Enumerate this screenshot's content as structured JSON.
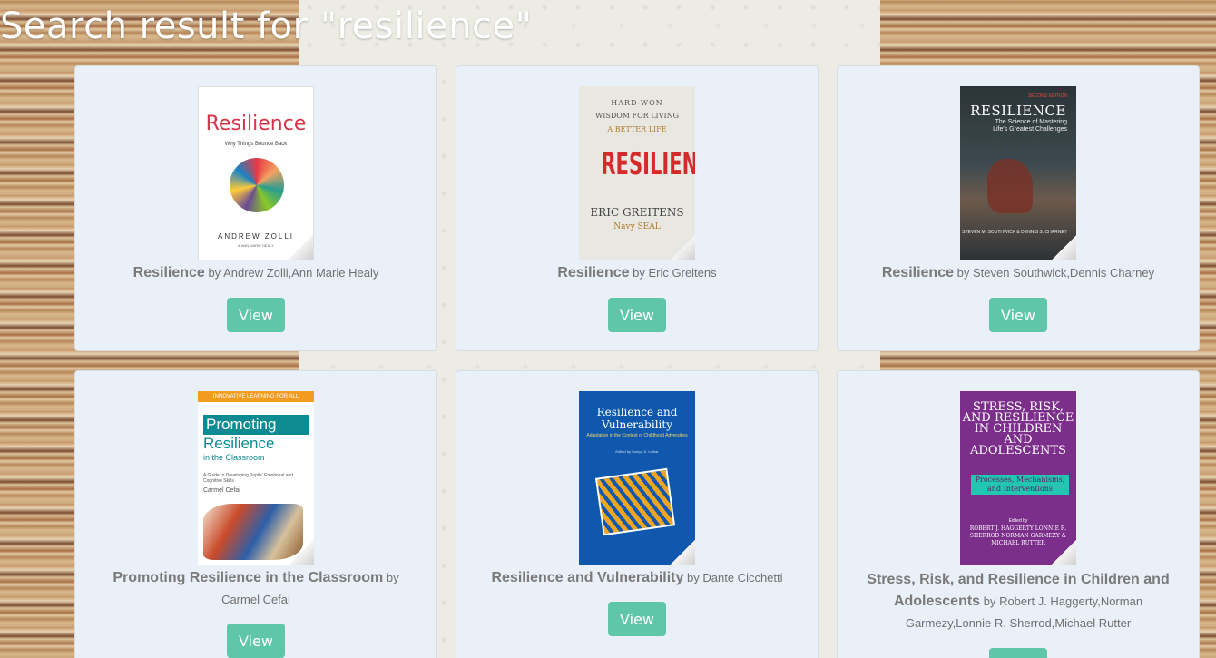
{
  "page": {
    "title": "Search result for \"resilience\""
  },
  "labels": {
    "by": "by",
    "view": "View"
  },
  "results": [
    {
      "title": "Resilience",
      "authors": "Andrew Zolli,Ann Marie Healy",
      "cover": {
        "title": "Resilience",
        "subtitle": "Why Things Bounce Back",
        "author": "ANDREW ZOLLI",
        "coauthor": "& ANN MARIE HEALY"
      }
    },
    {
      "title": "Resilience",
      "authors": "Eric Greitens",
      "cover": {
        "line1": "HARD-WON",
        "line2": "WISDOM FOR LIVING",
        "line3": "A BETTER LIFE",
        "title": "RESILIENCE",
        "author": "ERIC GREITENS",
        "tag": "Navy SEAL"
      }
    },
    {
      "title": "Resilience",
      "authors": "Steven Southwick,Dennis Charney",
      "cover": {
        "edition": "SECOND EDITION",
        "title": "RESILIENCE",
        "subtitle": "The Science of Mastering Life's Greatest Challenges",
        "author": "STEVEN M. SOUTHWICK & DENNIS S. CHARNEY"
      }
    },
    {
      "title": "Promoting Resilience in the Classroom",
      "authors": "Carmel Cefai",
      "cover": {
        "series": "INNOVATIVE LEARNING FOR ALL",
        "line1": "Promoting",
        "line2": "Resilience",
        "line3": "in the Classroom",
        "subtitle": "A Guide to Developing Pupils' Emotional and Cognitive Skills",
        "author": "Carmel Cefai"
      }
    },
    {
      "title": "Resilience and Vulnerability",
      "authors": "Dante Cicchetti",
      "cover": {
        "title": "Resilience and Vulnerability",
        "subtitle": "Adaptation in the Context of Childhood Adversities",
        "editor": "Edited by Suniya S. Luthar"
      }
    },
    {
      "title": "Stress, Risk, and Resilience in Children and Adolescents",
      "authors": "Robert J. Haggerty,Norman Garmezy,Lonnie R. Sherrod,Michael Rutter",
      "cover": {
        "title": "STRESS, RISK, AND RESILIENCE IN CHILDREN AND ADOLESCENTS",
        "subtitle": "Processes, Mechanisms, and Interventions",
        "edited": "Edited by",
        "authors": "ROBERT J. HAGGERTY LONNIE R. SHERROD NORMAN GARMEZY & MICHAEL RUTTER"
      }
    }
  ]
}
